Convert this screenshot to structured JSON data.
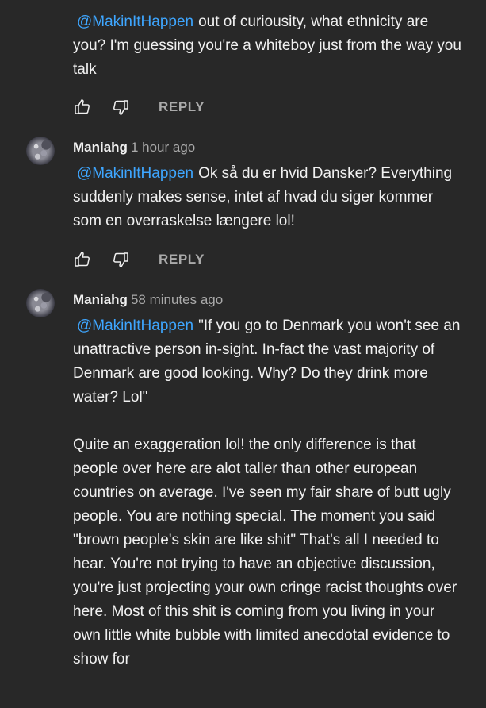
{
  "comments": [
    {
      "author": "",
      "time": "",
      "mention": "@MakinItHappen",
      "paragraphs": [
        "out of curiousity, what ethnicity are you? I'm guessing you're a whiteboy just from the way you talk"
      ],
      "reply_label": "REPLY"
    },
    {
      "author": "Maniahg",
      "time": "1 hour ago",
      "mention": "@MakinItHappen",
      "paragraphs": [
        "Ok så du er hvid Dansker? Everything suddenly makes sense, intet af hvad du siger kommer som en overraskelse længere lol!"
      ],
      "reply_label": "REPLY"
    },
    {
      "author": "Maniahg",
      "time": "58 minutes ago",
      "mention": "@MakinItHappen",
      "paragraphs": [
        "\"If you go to Denmark you won't see an unattractive person in-sight. In-fact the vast majority of Denmark are good looking. Why? Do they drink more water? Lol\"",
        "Quite an exaggeration lol! the only difference is that people over here are alot taller than other european countries on average. I've seen my fair share of butt ugly people. You are nothing special. The moment you said \"brown people's skin are like shit\" That's all I needed to hear. You're not trying to have an objective discussion, you're just projecting your own cringe racist thoughts over here. Most of this shit is coming from you living in your own little white bubble with limited anecdotal evidence to show for"
      ]
    }
  ],
  "icons": {
    "like": "thumbs-up-outline",
    "dislike": "thumbs-down-outline"
  },
  "colors": {
    "background": "#282828",
    "text": "#f1f1f1",
    "secondary": "#aaaaaa",
    "mention": "#3ea6ff"
  }
}
